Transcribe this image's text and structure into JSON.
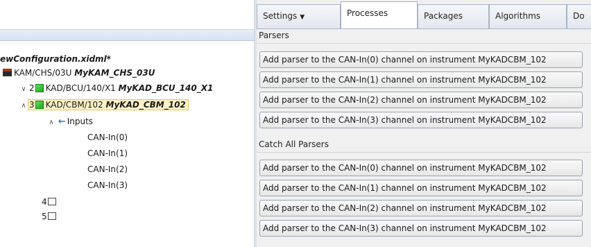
{
  "tree": {
    "file_title": "ewConfiguration.xidml*",
    "chassis": {
      "part": "KAM/CHS/03U",
      "name": "MyKAM_CHS_03U"
    },
    "modules": [
      {
        "slot": "2",
        "part": "KAD/BCU/140/X1",
        "name": "MyKAD_BCU_140_X1",
        "chevron": "collapsed"
      },
      {
        "slot": "3",
        "part": "KAD/CBM/102",
        "name": "MyKAD_CBM_102",
        "chevron": "expanded",
        "selected": true
      }
    ],
    "inputs_label": "Inputs",
    "channels": [
      "CAN-In(0)",
      "CAN-In(1)",
      "CAN-In(2)",
      "CAN-In(3)"
    ],
    "empty_slots": [
      "4",
      "5"
    ]
  },
  "tabs": [
    {
      "label": "Settings",
      "has_dropdown": true
    },
    {
      "label": "Processes",
      "active": true
    },
    {
      "label": "Packages"
    },
    {
      "label": "Algorithms"
    },
    {
      "label": "Do"
    }
  ],
  "sections": {
    "parsers": {
      "label": "Parsers",
      "buttons": [
        "Add parser to the CAN-In(0) channel on instrument MyKADCBM_102",
        "Add parser to the CAN-In(1) channel on instrument MyKADCBM_102",
        "Add parser to the CAN-In(2) channel on instrument MyKADCBM_102",
        "Add parser to the CAN-In(3) channel on instrument MyKADCBM_102"
      ]
    },
    "catch_all": {
      "label": "Catch All Parsers",
      "buttons": [
        "Add parser to the CAN-In(0) channel on instrument MyKADCBM_102",
        "Add parser to the CAN-In(1) channel on instrument MyKADCBM_102",
        "Add parser to the CAN-In(2) channel on instrument MyKADCBM_102",
        "Add parser to the CAN-In(3) channel on instrument MyKADCBM_102"
      ]
    }
  },
  "colors": {
    "selection_bg": "#fdf2c4",
    "module_icon": "#2fbf2f",
    "chassis_icon": "#9b3a10",
    "arrow_icon": "#2e7fd6"
  },
  "icons": {
    "chassis": "chassis-icon",
    "module": "green-module-icon",
    "empty_slot": "empty-slot-icon",
    "inputs": "left-arrow-icon",
    "tab_dropdown": "dropdown-arrow-icon"
  }
}
